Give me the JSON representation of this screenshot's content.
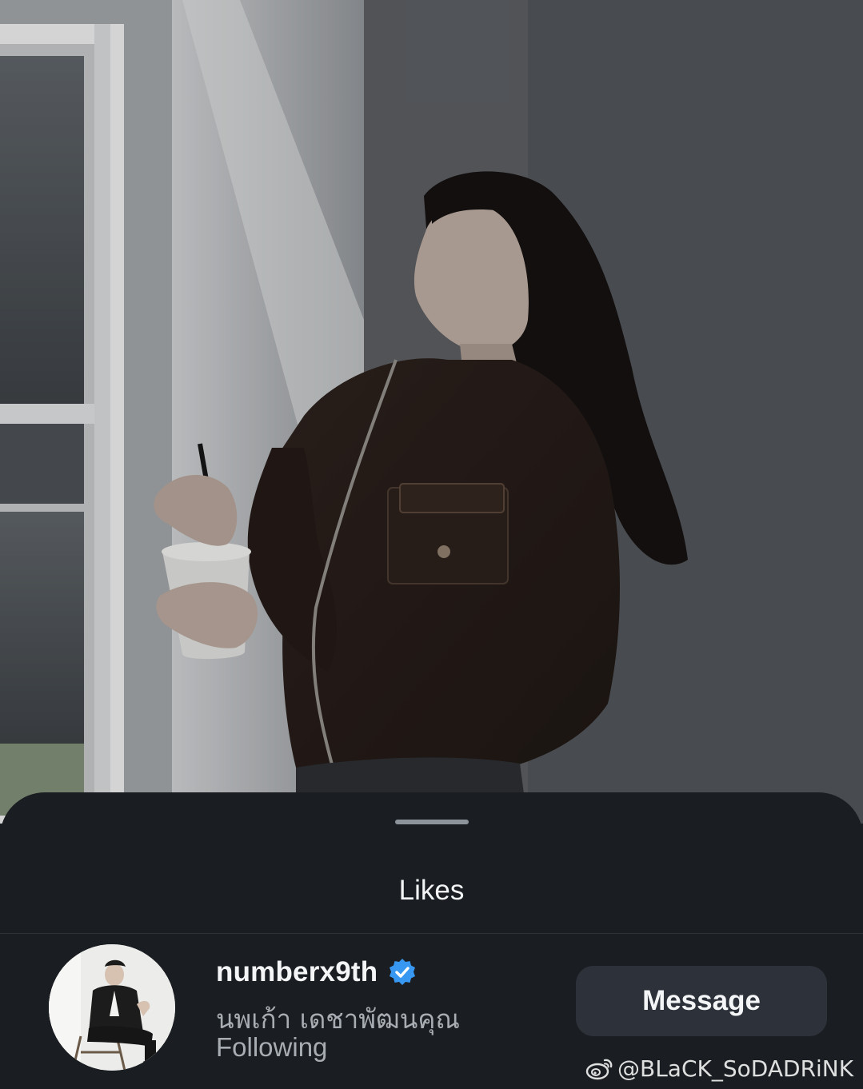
{
  "sheet": {
    "title": "Likes"
  },
  "likes": [
    {
      "username": "numberx9th",
      "verified": true,
      "full_name": "นพเก้า เดชาพัฒนคุณ",
      "status": "Following",
      "action_label": "Message"
    }
  ],
  "watermark": {
    "text": "@BLaCK_SoDADRiNK"
  },
  "colors": {
    "sheet_background": "#1a1d21",
    "button_background": "#2d323a",
    "verified_badge": "#3897f0",
    "secondary_text": "#a8adb3"
  },
  "icons": {
    "verified": "verified-badge-icon",
    "watermark": "weibo-logo-icon"
  }
}
